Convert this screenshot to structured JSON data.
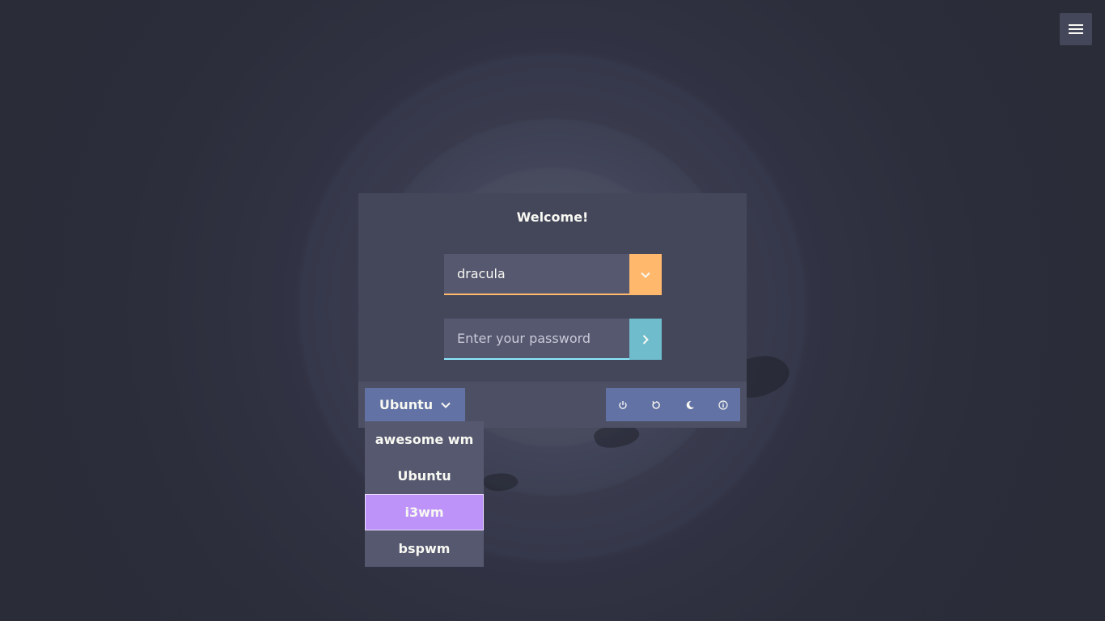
{
  "login": {
    "title": "Welcome!",
    "username_value": "dracula",
    "password_placeholder": "Enter your password"
  },
  "session": {
    "selected": "Ubuntu",
    "options": [
      {
        "label": "awesome wm"
      },
      {
        "label": "Ubuntu"
      },
      {
        "label": "i3wm",
        "highlighted": true
      },
      {
        "label": "bspwm"
      }
    ]
  },
  "icons": {
    "menu": "hamburger-menu-icon",
    "user_dropdown": "chevron-down-icon",
    "submit": "chevron-right-icon",
    "session_dropdown": "chevron-down-icon",
    "power": [
      "power-icon",
      "restart-icon",
      "sleep-moon-icon",
      "info-icon"
    ]
  },
  "colors": {
    "background": "#2a2c38",
    "card": "#44475a",
    "accent_orange": "#ffb86c",
    "accent_cyan": "#8be9fd",
    "accent_purple": "#bd93f9",
    "button": "#6272a4",
    "text": "#f8f8f2"
  }
}
